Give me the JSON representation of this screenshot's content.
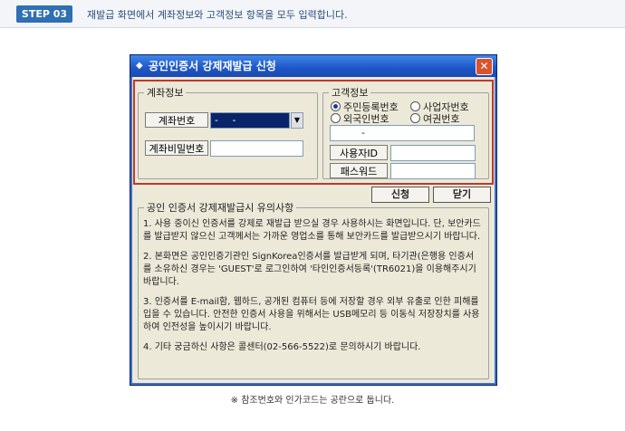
{
  "header": {
    "step_label": "STEP 03",
    "description": "재발급 화면에서 계좌정보와 고객정보 항목을 모두 입력합니다."
  },
  "dialog": {
    "title": "공인인증서 강제재발급 신청",
    "title_icon": "◆",
    "close_label": "✕",
    "account": {
      "legend": "계좌정보",
      "account_no_label": "계좌번호",
      "account_no_value": "- -",
      "password_label": "계좌비밀번호",
      "password_value": ""
    },
    "customer": {
      "legend": "고객정보",
      "radio_resident": "주민등록번호",
      "radio_business": "사업자번호",
      "radio_foreigner": "외국인번호",
      "radio_passport": "여권번호",
      "id_value": "-",
      "user_id_label": "사용자ID",
      "user_id_value": "",
      "password_label": "패스워드",
      "password_value": ""
    },
    "buttons": {
      "apply": "신청",
      "close": "닫기"
    },
    "notice": {
      "legend": "공인 인증서 강제재발급시 유의사항",
      "items": [
        "1. 사용 중이신 인증서를 강제로 재발급 받으실 경우 사용하시는 화면입니다. 단, 보안카드를 발급받지 않으신 고객께서는 가까운 영업소를 통해 보안카드를 발급받으시기 바랍니다.",
        "2. 본화면은 공인인증기관인 SignKorea인증서를 발급받게 되며, 타기관(은행용 인증서를 소유하신 경우는 'GUEST'로 로그인하여 '타인인증서등록'(TR6021)을 이용해주시기 바랍니다.",
        "3. 인증서를 E-mail함, 웹하드, 공개된 컴퓨터 등에 저장할 경우 외부 유출로 인한 피해를 입을 수 있습니다. 안전한 인증서 사용을 위해서는 USB메모리 등 이동식 저장장치를 사용하여 인전성을 높이시기 바랍니다.",
        "4. 기타 궁금하신 사항은 콜센터(02-566-5522)로 문의하시기 바랍니다."
      ]
    }
  },
  "footnote": "※ 참조번호와 인가코드는 공란으로 둡니다."
}
